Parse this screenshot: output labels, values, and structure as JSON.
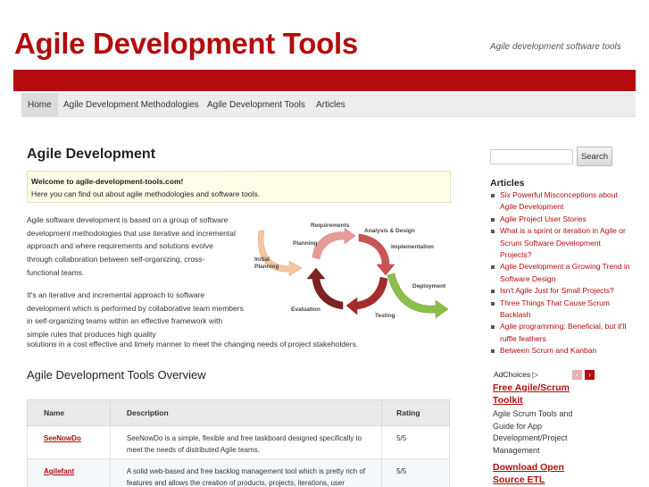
{
  "site": {
    "title": "Agile Development Tools",
    "description": "Agile development software tools"
  },
  "nav": {
    "items": [
      {
        "label": "Home",
        "active": true
      },
      {
        "label": "Agile Development Methodologies"
      },
      {
        "label": "Agile Development Tools"
      },
      {
        "label": "Articles"
      }
    ]
  },
  "main": {
    "title": "Agile Development",
    "welcome": {
      "heading": "Welcome to agile-development-tools.com!",
      "text": "Here you can find out about agile methodologies and software tools."
    },
    "paragraph1": "Agile software development is based on a group of software development methodologies that use iterative and incremental approach and where requirements and solutions evolve through collaboration between self-organizing, cross-functional teams.",
    "paragraph2": "It's an iterative and incremental approach to software development which is performed by collaborative team members in self-organizing teams within an effective framework with simple rules that produces high quality",
    "paragraph2_tail": "solutions in a cost effective and timely manner to meet the changing needs of project stakeholders.",
    "diagram": {
      "labels": {
        "requirements": "Requirements",
        "analysis": "Analysis & Design",
        "planning": "Planning",
        "implementation": "Implementation",
        "initial1": "Initial",
        "initial2": "Planning",
        "deployment": "Deployment",
        "evaluation": "Evaluation",
        "testing": "Testing"
      }
    },
    "overview_title": "Agile Development Tools Overview",
    "table": {
      "headers": [
        "Name",
        "Description",
        "Rating"
      ],
      "rows": [
        {
          "name": "SeeNowDo",
          "description": "SeeNowDo is a simple, flexible and free taskboard designed specifically to meet the needs of distributed Agile teams.",
          "rating": "5/5"
        },
        {
          "name": "Agilefant",
          "description": "A solid web-based and free backlog management tool which is pretty rich of features and allows the creation of products, projects, iterations, user",
          "rating": "5/5"
        }
      ]
    }
  },
  "sidebar": {
    "search_button": "Search",
    "search_value": "",
    "articles_heading": "Articles",
    "articles": [
      "Six Powerful Misconceptions about Agile Development",
      "Agile Project User Stories",
      "What is a sprint or iteration in Agile or Scrum Software Development Projects?",
      "Agile Development a Growing Trend in Software Design",
      "Isn't Agile Just for Small Projects?",
      "Three Things That Cause Scrum Backlash",
      "Agile programming: Beneficial, but it'll ruffle feathers",
      "Between Scrum and Kanban"
    ],
    "ads": {
      "adchoices": "AdChoices",
      "ad1_title": "Free Agile/Scrum Toolkit",
      "ad1_desc": "Agile Scrum Tools and Guide for App Development/Project Management",
      "ad2_title": "Download Open Source ETL"
    }
  },
  "colors": {
    "brand": "#b20c0c",
    "nav_bg": "#ececec",
    "welcome_bg": "#fffde8"
  }
}
